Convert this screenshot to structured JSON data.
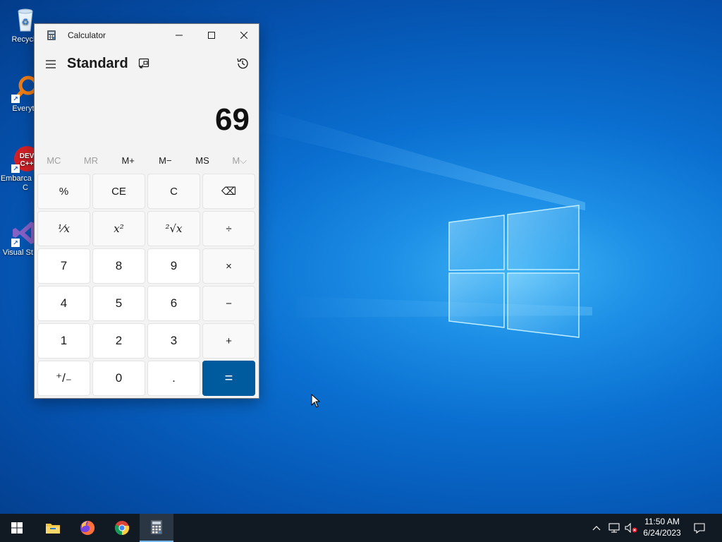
{
  "desktop": {
    "icons": [
      {
        "label": "Recycle",
        "icon": "recycle-bin-icon"
      },
      {
        "label": "Everyth",
        "icon": "everything-search-icon"
      },
      {
        "label": "Embarca Dev-C",
        "icon": "devcpp-icon"
      },
      {
        "label": "Visual St 201",
        "icon": "visual-studio-icon"
      }
    ]
  },
  "calculator": {
    "window_title": "Calculator",
    "mode": "Standard",
    "display": "69",
    "memory": [
      {
        "label": "MC",
        "enabled": false
      },
      {
        "label": "MR",
        "enabled": false
      },
      {
        "label": "M+",
        "enabled": true
      },
      {
        "label": "M−",
        "enabled": true
      },
      {
        "label": "MS",
        "enabled": true
      },
      {
        "label": "M⌵",
        "enabled": false
      }
    ],
    "keys": {
      "percent": "%",
      "ce": "CE",
      "c": "C",
      "backspace": "⌫",
      "reciprocal": "⅟x",
      "square": "x²",
      "sqrt": "²√x",
      "divide": "÷",
      "seven": "7",
      "eight": "8",
      "nine": "9",
      "multiply": "×",
      "four": "4",
      "five": "5",
      "six": "6",
      "minus": "−",
      "one": "1",
      "two": "2",
      "three": "3",
      "plus": "+",
      "negate": "⁺/₋",
      "zero": "0",
      "decimal": ".",
      "equals": "="
    },
    "accent_color": "#005a9e"
  },
  "taskbar": {
    "items": [
      "start-icon",
      "file-explorer-icon",
      "firefox-icon",
      "chrome-icon",
      "calculator-icon"
    ],
    "active": "calculator-icon",
    "clock_time": "11:50 AM",
    "clock_date": "6/24/2023"
  }
}
